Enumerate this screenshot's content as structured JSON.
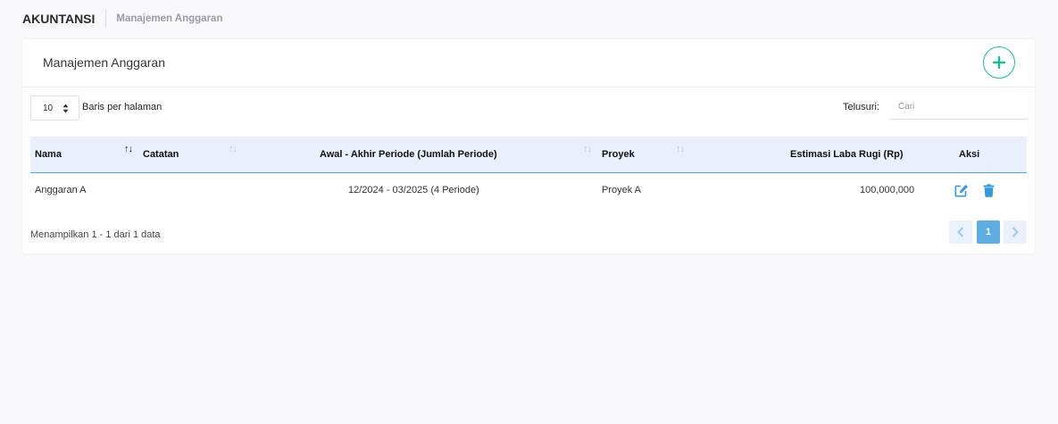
{
  "header": {
    "app_title": "AKUNTANSI",
    "breadcrumb": "Manajemen Anggaran"
  },
  "card": {
    "title": "Manajemen Anggaran"
  },
  "controls": {
    "per_page_value": "10",
    "per_page_label": "Baris per halaman",
    "search_label": "Telusuri:",
    "search_placeholder": "Cari"
  },
  "table": {
    "columns": {
      "nama": "Nama",
      "catatan": "Catatan",
      "periode": "Awal - Akhir Periode (Jumlah Periode)",
      "proyek": "Proyek",
      "estimasi": "Estimasi Laba Rugi (Rp)",
      "aksi": "Aksi"
    },
    "rows": [
      {
        "nama": "Anggaran A",
        "catatan": "",
        "periode": "12/2024 - 03/2025 (4 Periode)",
        "proyek": "Proyek A",
        "estimasi": "100,000,000"
      }
    ]
  },
  "footer": {
    "summary": "Menampilkan 1 - 1 dari 1 data",
    "current_page": "1"
  },
  "colors": {
    "accent_green": "#1abc9c",
    "accent_blue": "#5dade2",
    "header_bg": "#e9effb"
  },
  "icons": [
    "plus-icon",
    "sort-icon",
    "edit-icon",
    "trash-icon",
    "chevron-left-icon",
    "chevron-right-icon",
    "caret-updown-icon"
  ]
}
